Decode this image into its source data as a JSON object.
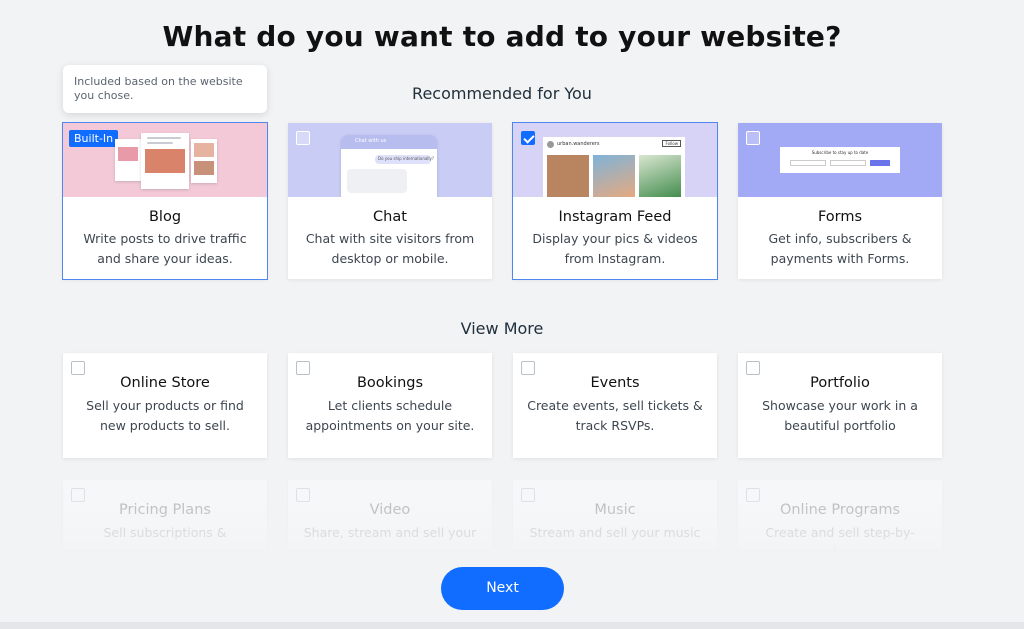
{
  "heading": "What do you want to add to your website?",
  "tooltip": "Included based on the website you chose.",
  "recommended_label": "Recommended for You",
  "view_more_label": "View More",
  "recommended": [
    {
      "title": "Blog",
      "desc": "Write posts to drive traffic and share your ideas.",
      "badge": "Built-In",
      "selected": true,
      "thumb_color": "#f3c9d8"
    },
    {
      "title": "Chat",
      "desc": "Chat with site visitors from desktop or mobile.",
      "selected": false,
      "thumb_color": "#c9cdf5",
      "thumb_texts": [
        "Chat with us",
        "Do you ship internationally?"
      ]
    },
    {
      "title": "Instagram Feed",
      "desc": "Display your pics & videos from Instagram.",
      "selected": true,
      "checked": true,
      "thumb_color": "#d7d3f6",
      "thumb_texts": [
        "urban.wanderers",
        "Follow"
      ]
    },
    {
      "title": "Forms",
      "desc": "Get info, subscribers & payments with Forms.",
      "selected": false,
      "thumb_color": "#a3aaf5",
      "thumb_texts": [
        "Subscribe to stay up to date"
      ]
    }
  ],
  "more": [
    {
      "title": "Online Store",
      "desc": "Sell your products or find new products to sell."
    },
    {
      "title": "Bookings",
      "desc": "Let clients schedule appointments on your site."
    },
    {
      "title": "Events",
      "desc": "Create events, sell tickets & track RSVPs."
    },
    {
      "title": "Portfolio",
      "desc": "Showcase your work in a beautiful portfolio"
    }
  ],
  "faded": [
    {
      "title": "Pricing Plans",
      "desc": "Sell subscriptions &"
    },
    {
      "title": "Video",
      "desc": "Share, stream and sell your"
    },
    {
      "title": "Music",
      "desc": "Stream and sell your music"
    },
    {
      "title": "Online Programs",
      "desc": "Create and sell step-by-step"
    }
  ],
  "next_label": "Next",
  "accent_color": "#116dff"
}
